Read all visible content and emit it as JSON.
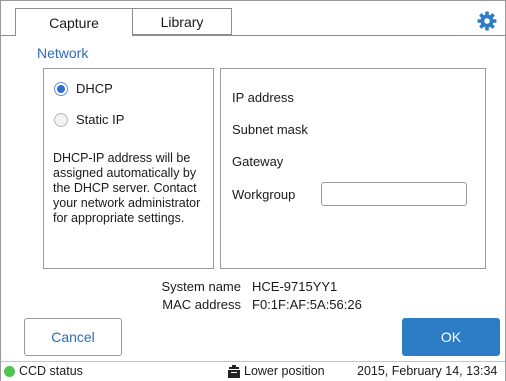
{
  "tabs": [
    {
      "label": "Capture",
      "active": true
    },
    {
      "label": "Library",
      "active": false
    }
  ],
  "settings_icon": "gear-icon",
  "accent_color": "#2c7cc6",
  "section": {
    "title": "Network"
  },
  "ip_mode": {
    "options": [
      {
        "label": "DHCP",
        "selected": true
      },
      {
        "label": "Static IP",
        "selected": false
      }
    ],
    "description": "DHCP-IP address will be assigned automatically by the DHCP server. Contact your network administrator for appropriate settings."
  },
  "network_fields": {
    "ip_address": "IP address",
    "subnet_mask": "Subnet mask",
    "gateway": "Gateway",
    "workgroup": "Workgroup",
    "workgroup_value": ""
  },
  "system": {
    "name_label": "System name",
    "name_value": "HCE-9715YY1",
    "mac_label": "MAC address",
    "mac_value": "F0:1F:AF:5A:56:26"
  },
  "buttons": {
    "cancel": "Cancel",
    "ok": "OK"
  },
  "status": {
    "ccd_label": "CCD status",
    "ccd_color": "#4fc24f",
    "position_label": "Lower position",
    "datetime": "2015, February 14, 13:34"
  }
}
